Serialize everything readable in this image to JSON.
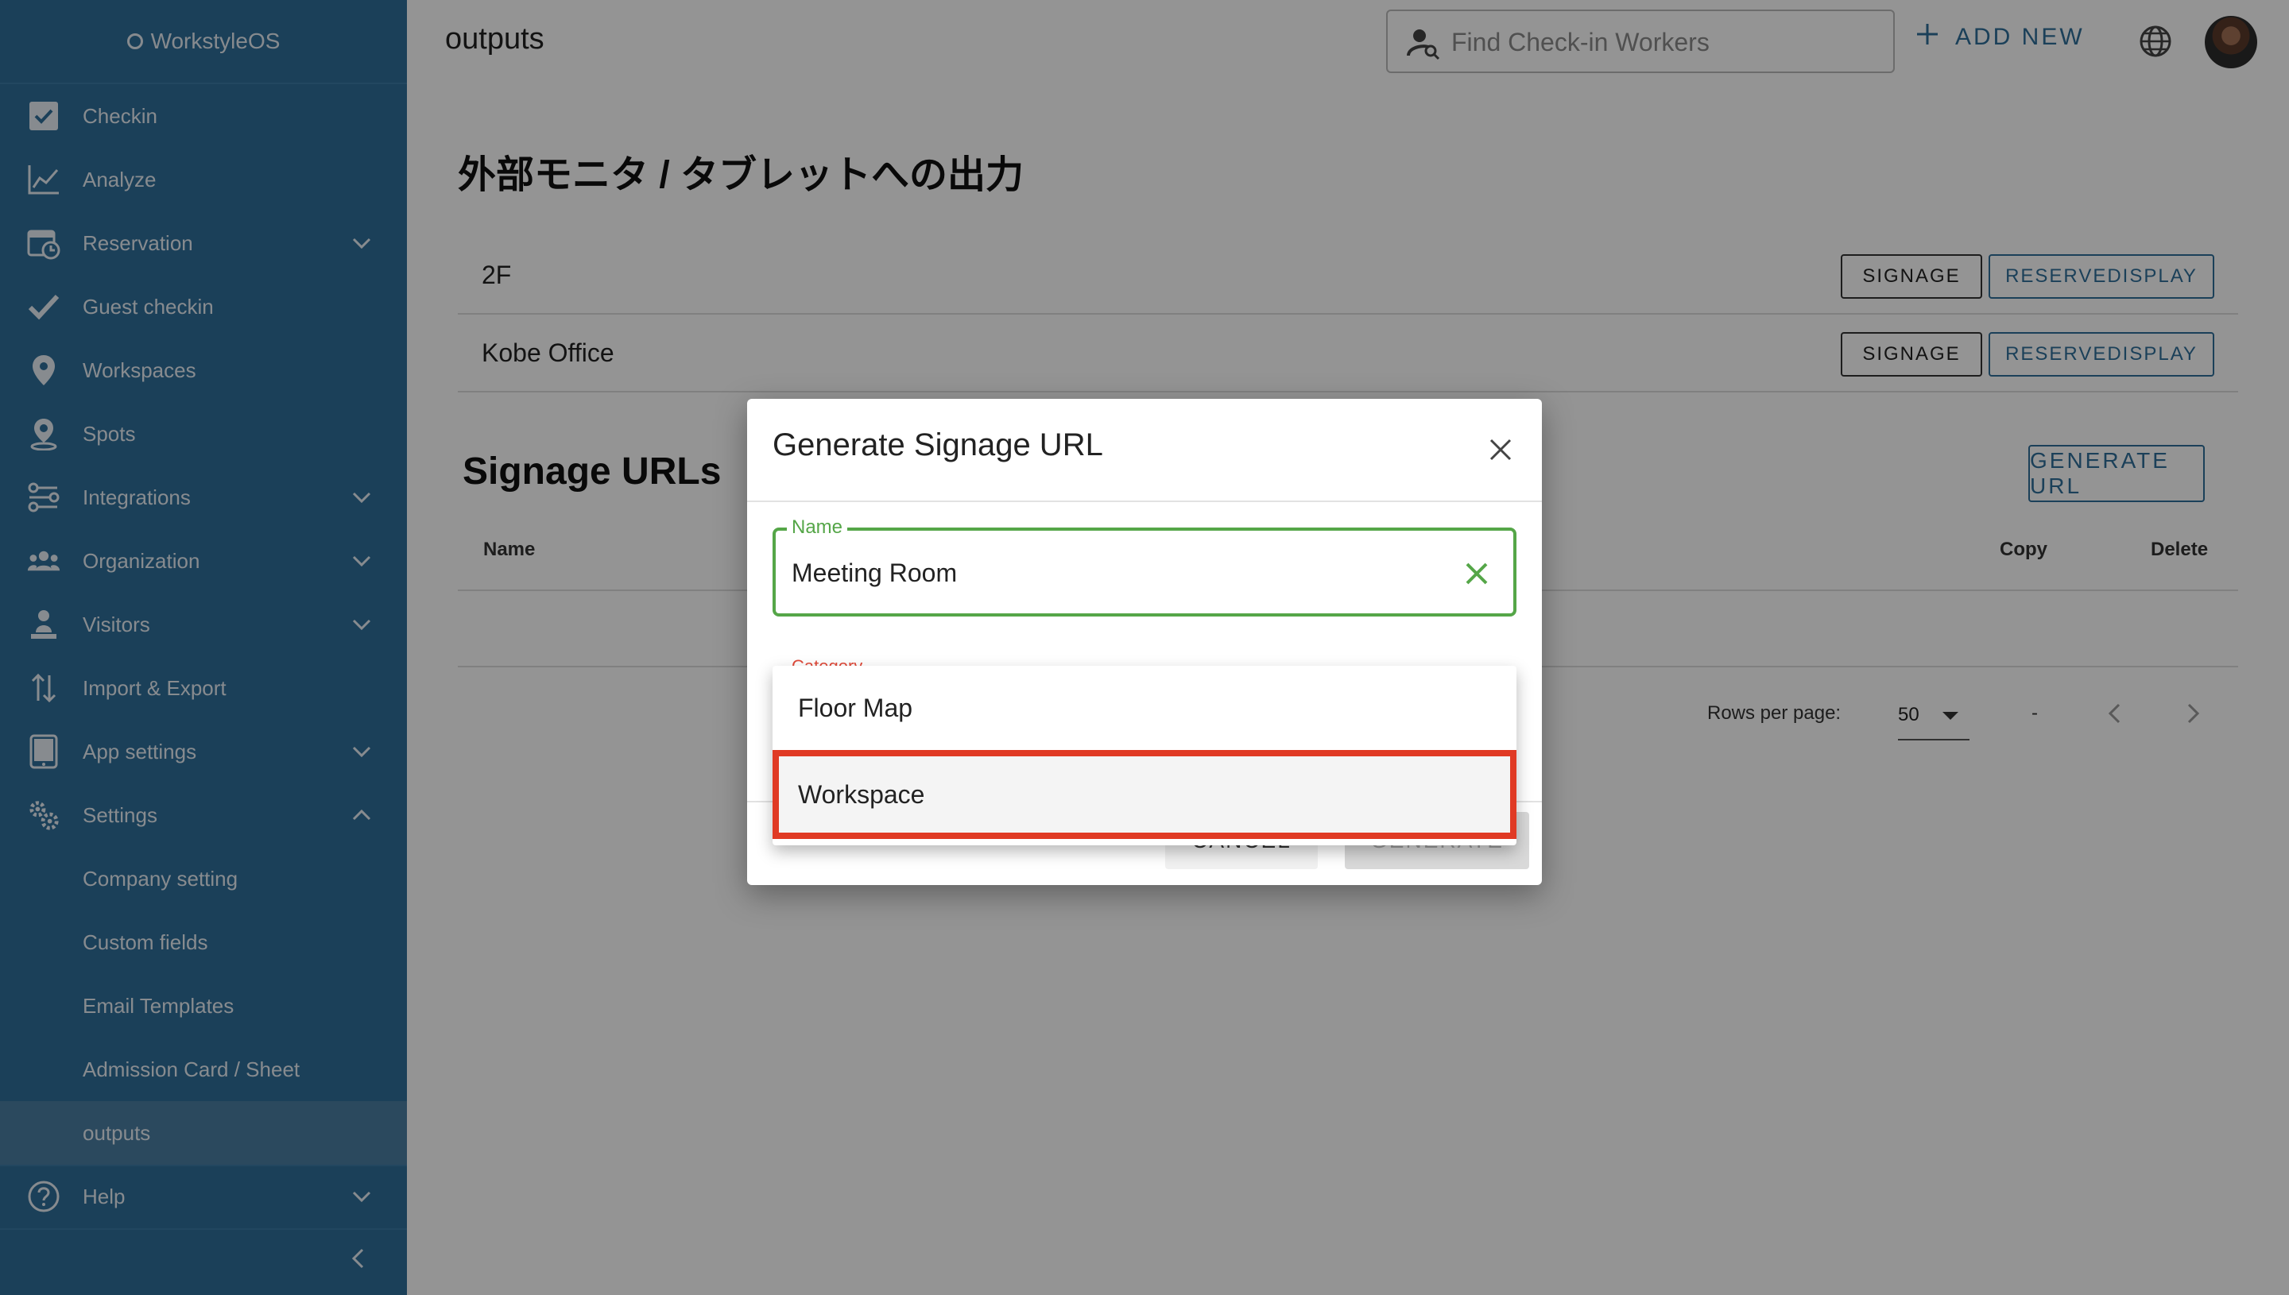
{
  "app": {
    "brand": "WorkstyleOS"
  },
  "sidebar": {
    "items": [
      {
        "label": "Checkin",
        "icon": "checkbox-icon"
      },
      {
        "label": "Analyze",
        "icon": "line-chart-icon"
      },
      {
        "label": "Reservation",
        "icon": "calendar-clock-icon"
      },
      {
        "label": "Guest checkin",
        "icon": "check-icon"
      },
      {
        "label": "Workspaces",
        "icon": "location-pin-icon"
      },
      {
        "label": "Spots",
        "icon": "spot-pin-icon"
      },
      {
        "label": "Integrations",
        "icon": "integrations-icon"
      },
      {
        "label": "Organization",
        "icon": "people-icon"
      },
      {
        "label": "Visitors",
        "icon": "visitor-icon"
      },
      {
        "label": "Import & Export",
        "icon": "import-export-icon"
      },
      {
        "label": "App settings",
        "icon": "tablet-icon"
      },
      {
        "label": "Settings",
        "icon": "gears-icon"
      }
    ],
    "settings_sub": [
      "Company setting",
      "Custom fields",
      "Email Templates",
      "Admission Card / Sheet",
      "outputs"
    ],
    "help": "Help"
  },
  "topbar": {
    "page_title": "outputs",
    "search_placeholder": "Find Check-in Workers",
    "add_new": "ADD NEW"
  },
  "outputs_section": {
    "title": "外部モニタ / タブレットへの出力",
    "rows": [
      {
        "name": "2F",
        "signage": "SIGNAGE",
        "reservedisplay": "RESERVEDISPLAY"
      },
      {
        "name": "Kobe Office",
        "signage": "SIGNAGE",
        "reservedisplay": "RESERVEDISPLAY"
      }
    ]
  },
  "signage_urls": {
    "title": "Signage URLs",
    "generate_url": "GENERATE URL",
    "columns": {
      "name": "Name",
      "copy": "Copy",
      "delete": "Delete"
    },
    "rows_per_page_label": "Rows per page:",
    "rows_per_page": "50",
    "range": "-"
  },
  "dialog": {
    "title": "Generate Signage URL",
    "name_label": "Name",
    "name_value": "Meeting Room",
    "category_label": "Category",
    "cancel": "CANCEL",
    "generate": "GENERATE"
  },
  "category_menu": {
    "options": [
      "Floor Map",
      "Workspace"
    ],
    "highlighted": "Workspace"
  },
  "colors": {
    "sidebar_bg": "#2f6e9a",
    "accent": "#2f6e9a",
    "field_ok": "#55a648",
    "error": "#e04a3a",
    "highlight_border": "#e03a24"
  }
}
